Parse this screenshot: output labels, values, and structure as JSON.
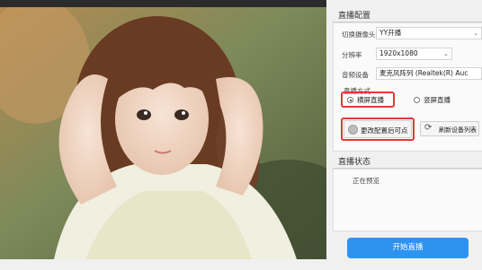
{
  "settings": {
    "title": "直播配置",
    "camera_label": "切换摄像头",
    "camera_value": "YY开播",
    "resolution_label": "分辨率",
    "resolution_value": "1920x1080",
    "audio_label": "音频设备",
    "audio_value": "麦克风阵列 (Realtek(R) Auc",
    "mode_label": "直播方式",
    "mode_options": [
      "横屏直播",
      "竖屏直播"
    ],
    "mode_selected": "横屏直播",
    "apply_button": "更改配置后可点",
    "refresh_button": "刷新设备列表"
  },
  "status": {
    "title": "直播状态",
    "text": "正在预览"
  },
  "start_button": "开始直播",
  "icons": {
    "chevron": "chevron-down-icon",
    "apply": "gear-circle-icon",
    "refresh": "refresh-icon"
  },
  "colors": {
    "accent": "#2d93f0",
    "highlight_red": "#e23a3a"
  }
}
